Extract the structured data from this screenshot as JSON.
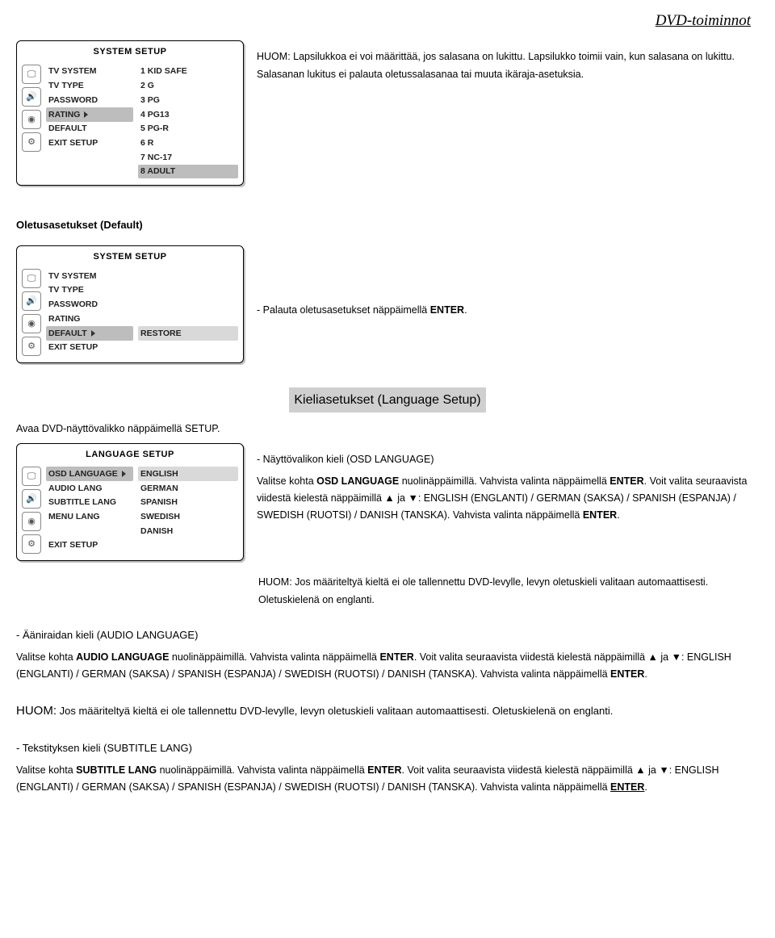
{
  "header": {
    "title": "DVD-toiminnot"
  },
  "osd1": {
    "title": "SYSTEM SETUP",
    "col1": [
      "TV SYSTEM",
      "TV TYPE",
      "PASSWORD",
      "RATING",
      "DEFAULT",
      "EXIT SETUP"
    ],
    "col2": [
      "1 KID SAFE",
      "2 G",
      "3 PG",
      "4 PG13",
      "5 PG-R",
      "6 R",
      "7 NC-17",
      "8 ADULT"
    ],
    "col1_hl_index": 3,
    "col2_hl_index": 7
  },
  "intro": {
    "p1": "HUOM: Lapsilukkoa ei voi määrittää, jos salasana on lukittu. Lapsilukko toimii vain, kun salasana on lukittu. Salasanan lukitus ei palauta oletussalasanaa tai muuta ikäraja-asetuksia."
  },
  "default_section": {
    "heading": "Oletusasetukset (Default)",
    "restore_text": "- Palauta oletusasetukset näppäimellä ",
    "restore_key": "ENTER",
    "period": "."
  },
  "osd2": {
    "title": "SYSTEM SETUP",
    "col1": [
      "TV SYSTEM",
      "TV TYPE",
      "PASSWORD",
      "RATING",
      "DEFAULT",
      "EXIT SETUP"
    ],
    "col2": [
      "RESTORE"
    ],
    "col1_hl_index": 4
  },
  "lang_heading": "Kieliasetukset (Language Setup)",
  "lang_open": "Avaa DVD-näyttövalikko näppäimellä SETUP.",
  "osd3": {
    "title": "LANGUAGE SETUP",
    "col1": [
      "OSD LANGUAGE",
      "AUDIO LANG",
      "SUBTITLE LANG",
      "MENU LANG",
      "",
      "EXIT SETUP"
    ],
    "col2": [
      "ENGLISH",
      "GERMAN",
      "SPANISH",
      "SWEDISH",
      "DANISH",
      ""
    ],
    "col1_hl_index": 0,
    "col2_hl_index": 0
  },
  "osd_lang": {
    "h": "- Näyttövalikon kieli (OSD LANGUAGE)",
    "p1a": "Valitse kohta ",
    "p1b": "OSD LANGUAGE",
    "p1c": " nuolinäppäimillä. Vahvista valinta näppäimellä ",
    "p1d": "ENTER",
    "p1e": ". Voit valita seuraavista viidestä kielestä näppäimillä ▲ ja ▼: ENGLISH (ENGLANTI) / GERMAN (SAKSA) / SPANISH (ESPANJA) / SWEDISH (RUOTSI) / DANISH (TANSKA). Vahvista valinta näppäimellä ",
    "p1f": "ENTER",
    "p1g": ".",
    "note": "HUOM: Jos määriteltyä kieltä ei ole tallennettu DVD-levylle, levyn oletuskieli valitaan automaattisesti. Oletuskielenä on englanti."
  },
  "audio_lang": {
    "h": "- Ääniraidan kieli (AUDIO LANGUAGE)",
    "p1a": "Valitse kohta ",
    "p1b": "AUDIO LANGUAGE",
    "p1c": " nuolinäppäimillä. Vahvista valinta näppäimellä ",
    "p1d": "ENTER",
    "p1e": ". Voit valita seuraavista viidestä kielestä näppäimillä ▲ ja ▼: ENGLISH (ENGLANTI) / GERMAN (SAKSA) / SPANISH (ESPANJA) / SWEDISH (RUOTSI) / DANISH (TANSKA). Vahvista valinta näppäimellä ",
    "p1f": "ENTER",
    "p1g": "."
  },
  "huom_big": {
    "label": "HUOM:",
    "text": " Jos määriteltyä kieltä ei ole tallennettu DVD-levylle, levyn oletuskieli valitaan automaattisesti. Oletuskielenä on englanti."
  },
  "subtitle_lang": {
    "h": "- Tekstityksen kieli (SUBTITLE LANG)",
    "p1a": "Valitse kohta ",
    "p1b": "SUBTITLE LANG",
    "p1c": " nuolinäppäimillä. Vahvista valinta näppäimellä ",
    "p1d": "ENTER",
    "p1e": ". Voit valita seuraavista viidestä kielestä näppäimillä ▲ ja ▼: ENGLISH (ENGLANTI) / GERMAN (SAKSA) / SPANISH (ESPANJA) / SWEDISH (RUOTSI) / DANISH (TANSKA). Vahvista valinta näppäimellä ",
    "p1f": "ENTER",
    "p1g": "."
  }
}
